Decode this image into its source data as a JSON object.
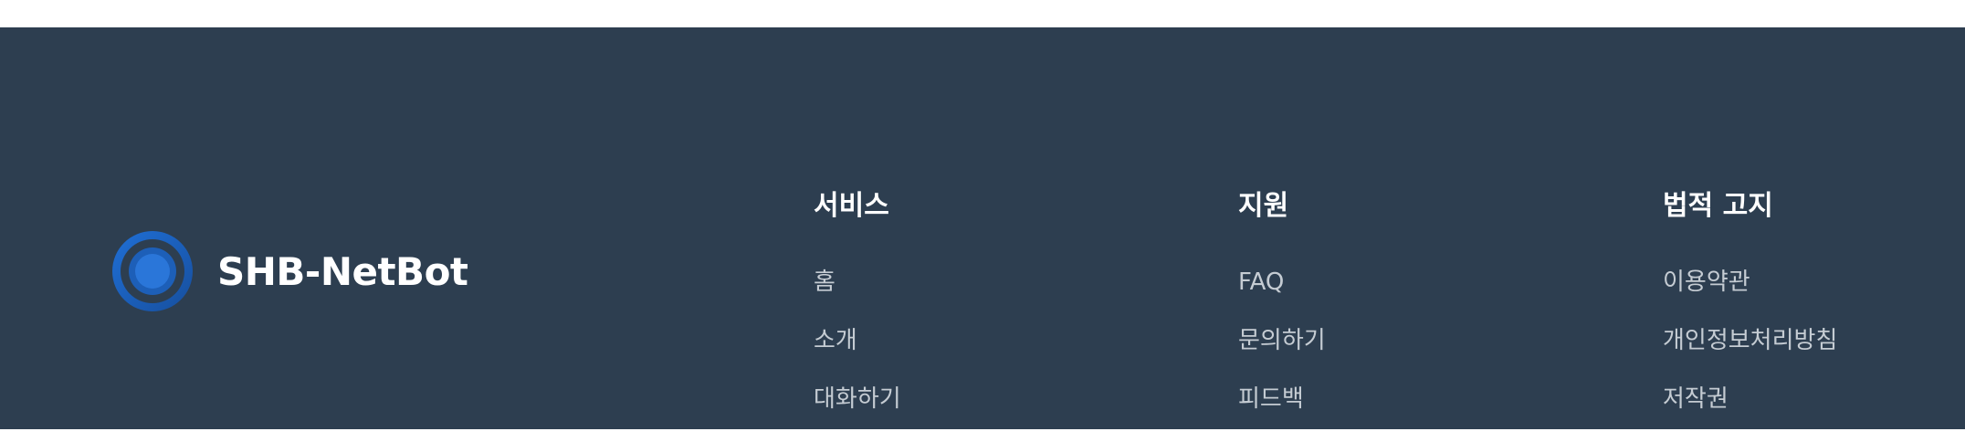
{
  "brand": {
    "name": "SHB-NetBot",
    "logo_icon": "target-ring-icon",
    "logo_colors": {
      "outer": "#1e5fb4",
      "inner": "#2a7ae0"
    }
  },
  "footer": {
    "background": "#2d3e50",
    "columns": [
      {
        "title": "서비스",
        "links": [
          "홈",
          "소개",
          "대화하기"
        ]
      },
      {
        "title": "지원",
        "links": [
          "FAQ",
          "문의하기",
          "피드백"
        ]
      },
      {
        "title": "법적 고지",
        "links": [
          "이용약관",
          "개인정보처리방침",
          "저작권"
        ]
      }
    ]
  }
}
